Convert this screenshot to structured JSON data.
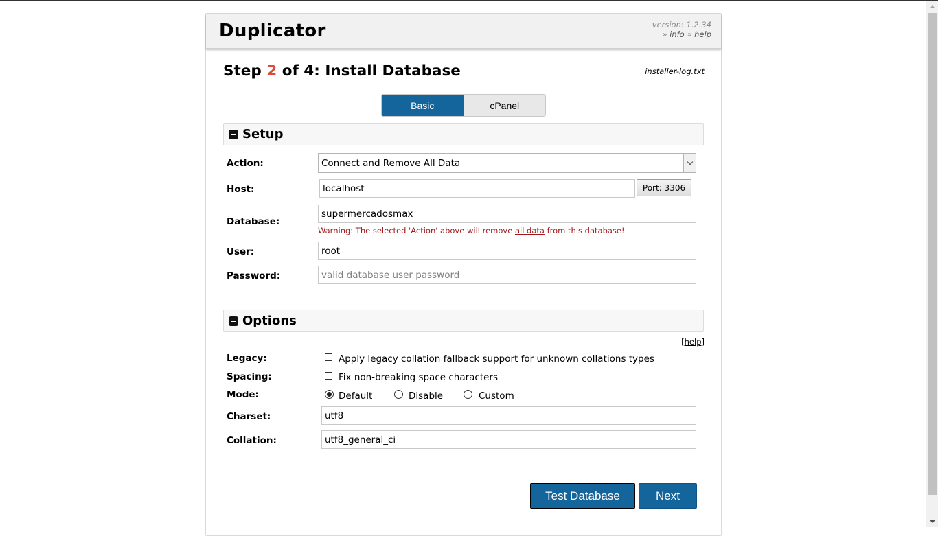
{
  "header": {
    "brand": "Duplicator",
    "version": "version: 1.2.34",
    "links_prefix": "» ",
    "links_separator": " » ",
    "info_link": "info",
    "help_link": "help"
  },
  "step": {
    "prefix": "Step ",
    "number": "2",
    "suffix": " of 4: Install Database",
    "log_link": "installer-log.txt"
  },
  "tabs": [
    {
      "label": "Basic",
      "active": true
    },
    {
      "label": "cPanel",
      "active": false
    }
  ],
  "setup": {
    "title": "Setup",
    "action_label": "Action:",
    "action_value": "Connect and Remove All Data",
    "host_label": "Host:",
    "host_value": "localhost",
    "port_button": "Port: 3306",
    "database_label": "Database:",
    "database_value": "supermercadosmax",
    "warning_before": "Warning: The selected 'Action' above will remove ",
    "warning_link": "all data",
    "warning_after": " from this database!",
    "user_label": "User:",
    "user_value": "root",
    "password_label": "Password:",
    "password_placeholder": "valid database user password"
  },
  "options": {
    "title": "Options",
    "help_link": "[help]",
    "legacy_label": "Legacy:",
    "legacy_text": "Apply legacy collation fallback support for unknown collations types",
    "legacy_checked": false,
    "spacing_label": "Spacing:",
    "spacing_text": "Fix non-breaking space characters",
    "spacing_checked": false,
    "mode_label": "Mode:",
    "mode_options": [
      {
        "label": "Default",
        "checked": true
      },
      {
        "label": "Disable",
        "checked": false
      },
      {
        "label": "Custom",
        "checked": false
      }
    ],
    "charset_label": "Charset:",
    "charset_value": "utf8",
    "collation_label": "Collation:",
    "collation_value": "utf8_general_ci"
  },
  "buttons": {
    "test_database": "Test Database",
    "next": "Next"
  },
  "colors": {
    "primary": "#13659c",
    "step_number": "#db4b3c",
    "warning": "#a41a1a"
  }
}
